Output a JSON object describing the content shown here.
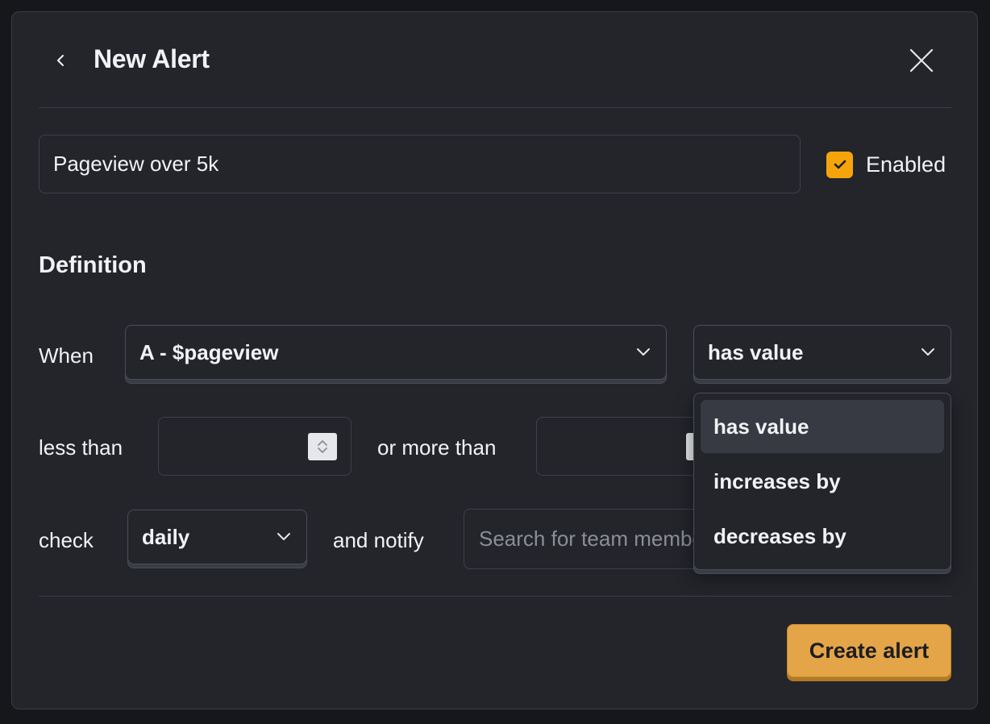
{
  "modal": {
    "title": "New Alert",
    "back_icon": "chevron-left-icon",
    "close_icon": "close-icon"
  },
  "alert": {
    "name_value": "Pageview over 5k",
    "enabled": true,
    "enabled_label": "Enabled"
  },
  "definition": {
    "section_title": "Definition",
    "when_label": "When",
    "series_value": "A - $pageview",
    "condition_value": "has value",
    "less_than_label": "less than",
    "less_than_value": "",
    "more_than_label": "or more than",
    "more_than_value": "",
    "check_label": "check",
    "frequency_value": "daily",
    "notify_label": "and notify",
    "notify_placeholder": "Search for team members to notify..."
  },
  "condition_dropdown": {
    "options": [
      "has value",
      "increases by",
      "decreases by"
    ],
    "highlighted_index": 0
  },
  "footer": {
    "create_label": "Create alert"
  },
  "colors": {
    "background": "#23252b",
    "accent": "#f5a50b",
    "primary_button": "#e3a548"
  }
}
